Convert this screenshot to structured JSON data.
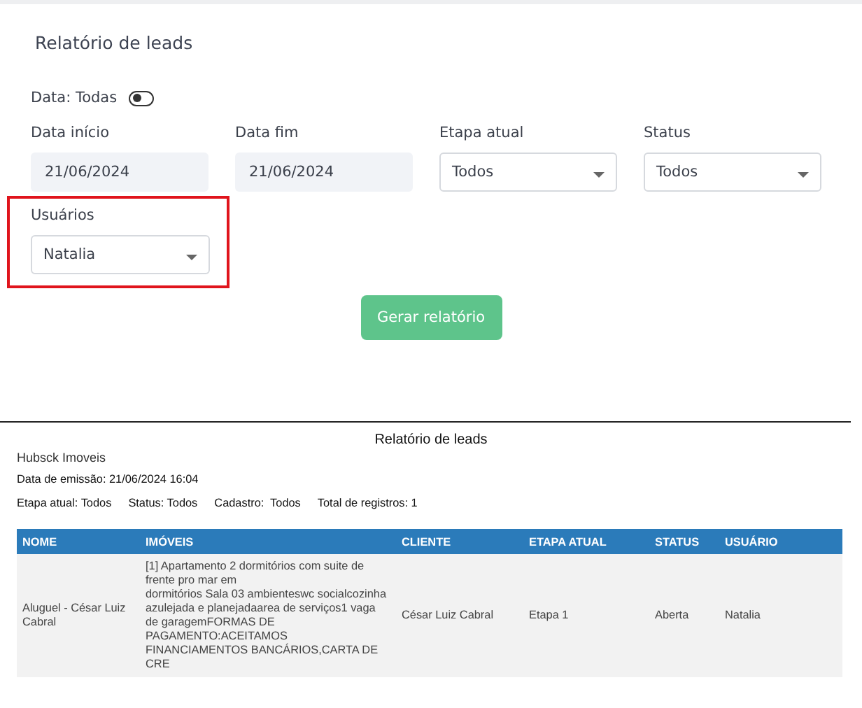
{
  "form": {
    "title": "Relatório de leads",
    "date_toggle": {
      "label": "Data: Todas",
      "on": false
    },
    "fields": [
      {
        "label": "Data início",
        "kind": "date",
        "value": "21/06/2024"
      },
      {
        "label": "Data fim",
        "kind": "date",
        "value": "21/06/2024"
      },
      {
        "label": "Etapa atual",
        "kind": "select",
        "value": "Todos"
      },
      {
        "label": "Status",
        "kind": "select",
        "value": "Todos"
      },
      {
        "label": "Usuários",
        "kind": "select",
        "value": "Natalia",
        "highlighted": true
      }
    ],
    "submit_button": "Gerar relatório"
  },
  "report": {
    "title": "Relatório de leads",
    "company": "Hubsck Imoveis",
    "issued": "Data de emissão: 21/06/2024 16:04",
    "summary": [
      "Etapa atual: Todos",
      "Status: Todos",
      "Cadastro:  Todos",
      "Total de registros: 1"
    ],
    "table": {
      "columns": [
        "NOME",
        "IMÓVEIS",
        "CLIENTE",
        "ETAPA ATUAL",
        "STATUS",
        "USUÁRIO"
      ],
      "rows": [
        [
          "Aluguel - César Luiz Cabral",
          "[1] Apartamento 2 dormitórios com suite de frente pro mar em\ndormitórios Sala 03 ambienteswc socialcozinha azulejada e planejadaarea de serviços1 vaga de garagemFORMAS DE PAGAMENTO:ACEITAMOS FINANCIAMENTOS BANCÁRIOS,CARTA DE CRE",
          "César Luiz Cabral",
          "Etapa 1",
          "Aberta",
          "Natalia"
        ]
      ]
    }
  }
}
